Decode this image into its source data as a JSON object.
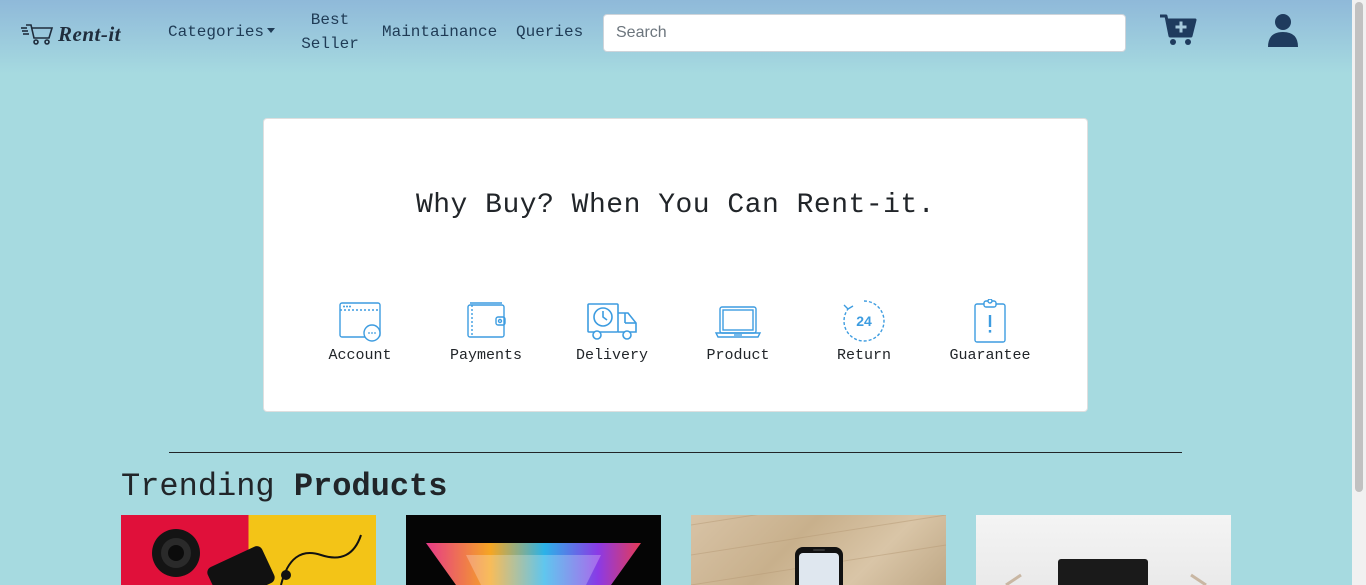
{
  "navbar": {
    "brand": "Rent-it",
    "links": {
      "categories": "Categories",
      "best_seller_line1": "Best",
      "best_seller_line2": "Seller",
      "maintainance": "Maintainance",
      "queries": "Queries"
    },
    "search": {
      "placeholder": "Search",
      "value": ""
    },
    "icons": [
      "cart-icon",
      "cart-plus-icon",
      "user-icon",
      "caret-down-icon"
    ]
  },
  "hero": {
    "title": "Why Buy? When You Can Rent-it.",
    "features": [
      {
        "label": "Account",
        "icon": "account-window-icon"
      },
      {
        "label": "Payments",
        "icon": "wallet-icon"
      },
      {
        "label": "Delivery",
        "icon": "delivery-truck-icon"
      },
      {
        "label": "Product",
        "icon": "laptop-icon"
      },
      {
        "label": "Return",
        "icon": "24-hour-return-icon"
      },
      {
        "label": "Guarantee",
        "icon": "clipboard-alert-icon"
      }
    ]
  },
  "trending": {
    "title_regular": "Trending",
    "title_bold": "Products",
    "products": [
      {
        "image": "camera-lens-and-earphones-on-red-yellow"
      },
      {
        "image": "colorful-laptop-on-black"
      },
      {
        "image": "smartphone-on-wood"
      },
      {
        "image": "tablet-on-white-desk"
      }
    ]
  },
  "colors": {
    "background": "#a6dae0",
    "navbar_top": "#8fb9d9",
    "icon_blue": "#3d9ce0",
    "nav_text": "#1f3b55"
  }
}
